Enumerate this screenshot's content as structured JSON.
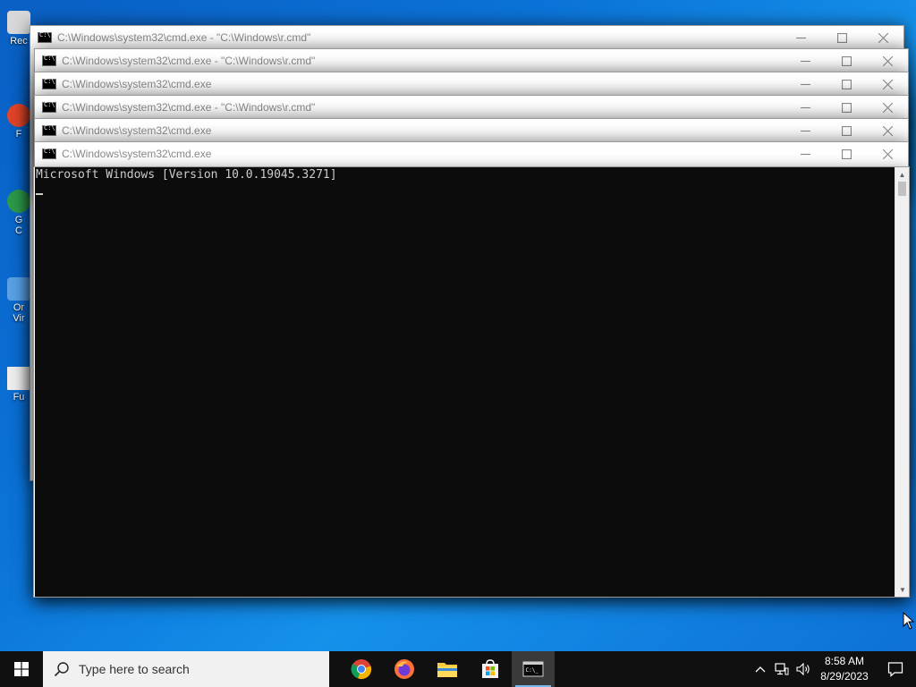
{
  "desktop": {
    "icons": [
      {
        "label": "Rec",
        "color": "#d8d8d8"
      },
      {
        "label": "F",
        "color": "#e2462b"
      },
      {
        "label": "G\nC",
        "color": "#2e9a4b"
      },
      {
        "label": "Or\nVir",
        "color": "#5aa1e6"
      },
      {
        "label": "Fu",
        "color": "#efefef"
      }
    ]
  },
  "windows": [
    {
      "title": "C:\\Windows\\system32\\cmd.exe - \"C:\\Windows\\r.cmd\""
    },
    {
      "title": "C:\\Windows\\system32\\cmd.exe - \"C:\\Windows\\r.cmd\""
    },
    {
      "title": "C:\\Windows\\system32\\cmd.exe"
    },
    {
      "title": "C:\\Windows\\system32\\cmd.exe - \"C:\\Windows\\r.cmd\""
    },
    {
      "title": "C:\\Windows\\system32\\cmd.exe"
    },
    {
      "title": "C:\\Windows\\system32\\cmd.exe",
      "console_lines": [
        "Microsoft Windows [Version 10.0.19045.3271]"
      ]
    }
  ],
  "taskbar": {
    "search_placeholder": "Type here to search",
    "apps": [
      {
        "name": "chrome-icon"
      },
      {
        "name": "firefox-icon"
      },
      {
        "name": "file-explorer-icon"
      },
      {
        "name": "microsoft-store-icon"
      },
      {
        "name": "command-prompt-icon",
        "active": true
      }
    ],
    "clock": {
      "time": "8:58 AM",
      "date": "8/29/2023"
    }
  }
}
